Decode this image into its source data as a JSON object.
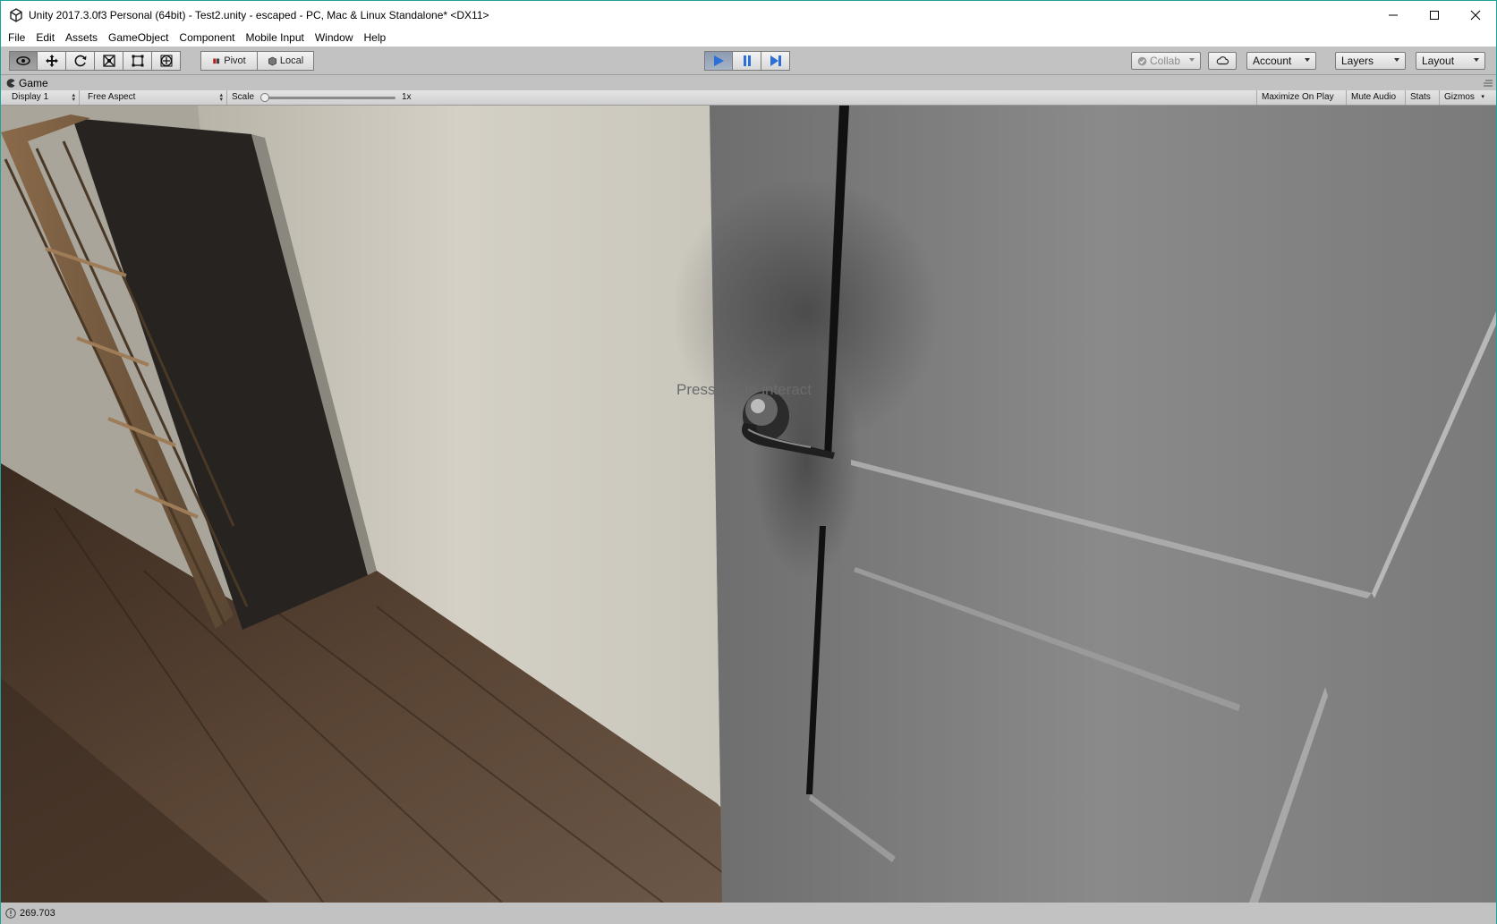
{
  "window": {
    "title": "Unity 2017.3.0f3 Personal (64bit) - Test2.unity - escaped - PC, Mac & Linux Standalone* <DX11>"
  },
  "menu": [
    "File",
    "Edit",
    "Assets",
    "GameObject",
    "Component",
    "Mobile Input",
    "Window",
    "Help"
  ],
  "toolbar": {
    "tools": [
      "hand-tool",
      "move-tool",
      "rotate-tool",
      "scale-tool",
      "rect-tool",
      "transform-tool"
    ],
    "pivot_label": "Pivot",
    "local_label": "Local",
    "collab_label": "Collab",
    "account_label": "Account",
    "layers_label": "Layers",
    "layout_label": "Layout",
    "play_active": true
  },
  "game_panel": {
    "tab_label": "Game",
    "display_label": "Display 1",
    "aspect_label": "Free Aspect",
    "scale_label": "Scale",
    "scale_value": "1x",
    "scale_level": 0.0,
    "maximize_label": "Maximize On Play",
    "mute_label": "Mute Audio",
    "stats_label": "Stats",
    "gizmos_label": "Gizmos"
  },
  "scene": {
    "prompt_text": "Press \"E\" to interact"
  },
  "status": {
    "message": "269.703"
  },
  "colors": {
    "accent_blue": "#2c6fd6",
    "window_border": "#1ba39c",
    "editor_gray": "#c2c2c2"
  }
}
